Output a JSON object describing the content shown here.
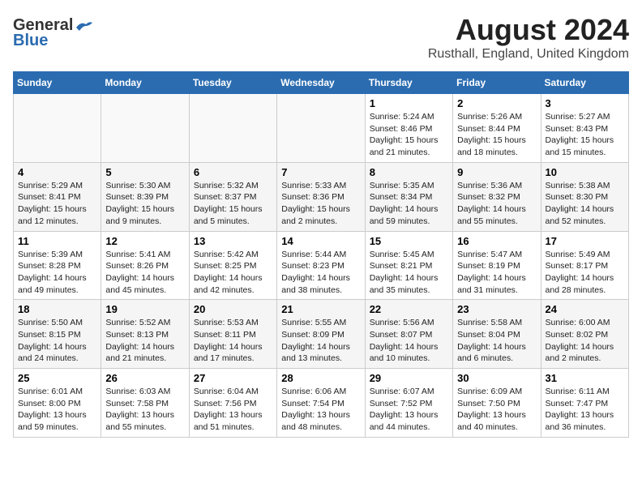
{
  "logo": {
    "line1": "General",
    "line2": "Blue"
  },
  "header": {
    "title": "August 2024",
    "subtitle": "Rusthall, England, United Kingdom"
  },
  "columns": [
    "Sunday",
    "Monday",
    "Tuesday",
    "Wednesday",
    "Thursday",
    "Friday",
    "Saturday"
  ],
  "weeks": [
    [
      {
        "day": "",
        "info": ""
      },
      {
        "day": "",
        "info": ""
      },
      {
        "day": "",
        "info": ""
      },
      {
        "day": "",
        "info": ""
      },
      {
        "day": "1",
        "info": "Sunrise: 5:24 AM\nSunset: 8:46 PM\nDaylight: 15 hours\nand 21 minutes."
      },
      {
        "day": "2",
        "info": "Sunrise: 5:26 AM\nSunset: 8:44 PM\nDaylight: 15 hours\nand 18 minutes."
      },
      {
        "day": "3",
        "info": "Sunrise: 5:27 AM\nSunset: 8:43 PM\nDaylight: 15 hours\nand 15 minutes."
      }
    ],
    [
      {
        "day": "4",
        "info": "Sunrise: 5:29 AM\nSunset: 8:41 PM\nDaylight: 15 hours\nand 12 minutes."
      },
      {
        "day": "5",
        "info": "Sunrise: 5:30 AM\nSunset: 8:39 PM\nDaylight: 15 hours\nand 9 minutes."
      },
      {
        "day": "6",
        "info": "Sunrise: 5:32 AM\nSunset: 8:37 PM\nDaylight: 15 hours\nand 5 minutes."
      },
      {
        "day": "7",
        "info": "Sunrise: 5:33 AM\nSunset: 8:36 PM\nDaylight: 15 hours\nand 2 minutes."
      },
      {
        "day": "8",
        "info": "Sunrise: 5:35 AM\nSunset: 8:34 PM\nDaylight: 14 hours\nand 59 minutes."
      },
      {
        "day": "9",
        "info": "Sunrise: 5:36 AM\nSunset: 8:32 PM\nDaylight: 14 hours\nand 55 minutes."
      },
      {
        "day": "10",
        "info": "Sunrise: 5:38 AM\nSunset: 8:30 PM\nDaylight: 14 hours\nand 52 minutes."
      }
    ],
    [
      {
        "day": "11",
        "info": "Sunrise: 5:39 AM\nSunset: 8:28 PM\nDaylight: 14 hours\nand 49 minutes."
      },
      {
        "day": "12",
        "info": "Sunrise: 5:41 AM\nSunset: 8:26 PM\nDaylight: 14 hours\nand 45 minutes."
      },
      {
        "day": "13",
        "info": "Sunrise: 5:42 AM\nSunset: 8:25 PM\nDaylight: 14 hours\nand 42 minutes."
      },
      {
        "day": "14",
        "info": "Sunrise: 5:44 AM\nSunset: 8:23 PM\nDaylight: 14 hours\nand 38 minutes."
      },
      {
        "day": "15",
        "info": "Sunrise: 5:45 AM\nSunset: 8:21 PM\nDaylight: 14 hours\nand 35 minutes."
      },
      {
        "day": "16",
        "info": "Sunrise: 5:47 AM\nSunset: 8:19 PM\nDaylight: 14 hours\nand 31 minutes."
      },
      {
        "day": "17",
        "info": "Sunrise: 5:49 AM\nSunset: 8:17 PM\nDaylight: 14 hours\nand 28 minutes."
      }
    ],
    [
      {
        "day": "18",
        "info": "Sunrise: 5:50 AM\nSunset: 8:15 PM\nDaylight: 14 hours\nand 24 minutes."
      },
      {
        "day": "19",
        "info": "Sunrise: 5:52 AM\nSunset: 8:13 PM\nDaylight: 14 hours\nand 21 minutes."
      },
      {
        "day": "20",
        "info": "Sunrise: 5:53 AM\nSunset: 8:11 PM\nDaylight: 14 hours\nand 17 minutes."
      },
      {
        "day": "21",
        "info": "Sunrise: 5:55 AM\nSunset: 8:09 PM\nDaylight: 14 hours\nand 13 minutes."
      },
      {
        "day": "22",
        "info": "Sunrise: 5:56 AM\nSunset: 8:07 PM\nDaylight: 14 hours\nand 10 minutes."
      },
      {
        "day": "23",
        "info": "Sunrise: 5:58 AM\nSunset: 8:04 PM\nDaylight: 14 hours\nand 6 minutes."
      },
      {
        "day": "24",
        "info": "Sunrise: 6:00 AM\nSunset: 8:02 PM\nDaylight: 14 hours\nand 2 minutes."
      }
    ],
    [
      {
        "day": "25",
        "info": "Sunrise: 6:01 AM\nSunset: 8:00 PM\nDaylight: 13 hours\nand 59 minutes."
      },
      {
        "day": "26",
        "info": "Sunrise: 6:03 AM\nSunset: 7:58 PM\nDaylight: 13 hours\nand 55 minutes."
      },
      {
        "day": "27",
        "info": "Sunrise: 6:04 AM\nSunset: 7:56 PM\nDaylight: 13 hours\nand 51 minutes."
      },
      {
        "day": "28",
        "info": "Sunrise: 6:06 AM\nSunset: 7:54 PM\nDaylight: 13 hours\nand 48 minutes."
      },
      {
        "day": "29",
        "info": "Sunrise: 6:07 AM\nSunset: 7:52 PM\nDaylight: 13 hours\nand 44 minutes."
      },
      {
        "day": "30",
        "info": "Sunrise: 6:09 AM\nSunset: 7:50 PM\nDaylight: 13 hours\nand 40 minutes."
      },
      {
        "day": "31",
        "info": "Sunrise: 6:11 AM\nSunset: 7:47 PM\nDaylight: 13 hours\nand 36 minutes."
      }
    ]
  ]
}
